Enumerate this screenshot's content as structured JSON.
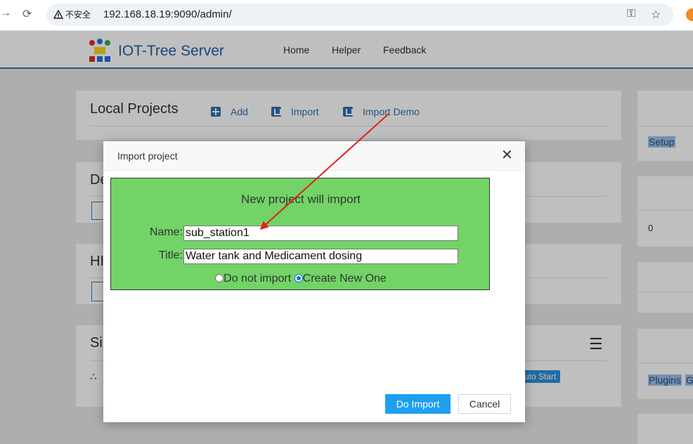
{
  "browser": {
    "security_label": "不安全",
    "url": "192.168.18.19:9090/admin/"
  },
  "app": {
    "brand": "IOT-Tree Server",
    "nav": [
      "Home",
      "Helper",
      "Feedback"
    ]
  },
  "local_projects": {
    "title": "Local Projects",
    "actions": [
      "Add",
      "Import",
      "Import Demo"
    ]
  },
  "background_panels": {
    "panel2_title_fragment": "De",
    "panel3_title_fragment": "HI",
    "panel4_title_fragment": "Si",
    "auto_start_fragment": "uto Start"
  },
  "side": {
    "setup": "Setup",
    "count": "0",
    "plugins": "Plugins",
    "extra": "G"
  },
  "modal": {
    "title": "Import project",
    "heading": "New project will import",
    "name_label": "Name:",
    "name_value": "sub_station1",
    "title_label": "Title:",
    "title_value": "Water tank and Medicament dosing",
    "radio_do_not_import": "Do not import",
    "radio_create_new": "Create New One",
    "selected_option": "Create New One",
    "do_import": "Do Import",
    "cancel": "Cancel"
  },
  "colors": {
    "accent": "#2f79bf",
    "modal_form_bg": "#72d467",
    "primary_button": "#1e9ff2",
    "annotation_arrow": "#e02020"
  }
}
